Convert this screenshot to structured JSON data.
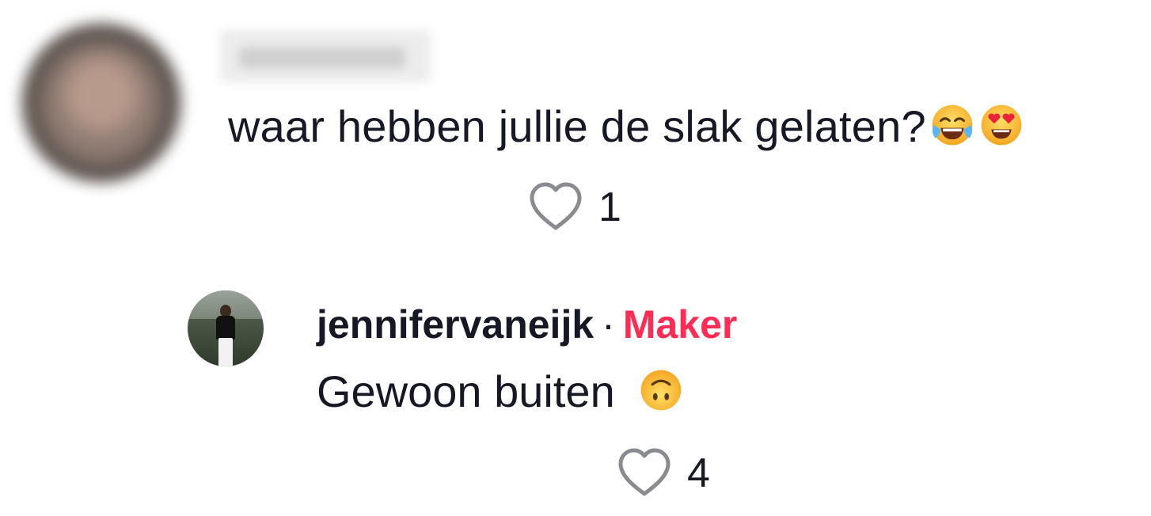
{
  "comment": {
    "author_name": "",
    "text": "waar hebben jullie de slak gelaten?",
    "emojis": [
      "face-with-tears-of-joy",
      "smiling-face-with-heart-eyes"
    ],
    "like_count": "1"
  },
  "reply": {
    "author_name": "jennifervaneijk",
    "separator": "·",
    "badge": "Maker",
    "text": "Gewoon buiten",
    "emojis": [
      "upside-down-face"
    ],
    "like_count": "4"
  },
  "colors": {
    "text": "#161823",
    "creator_badge": "#fe2c55",
    "heart_outline": "#8a8b91"
  }
}
